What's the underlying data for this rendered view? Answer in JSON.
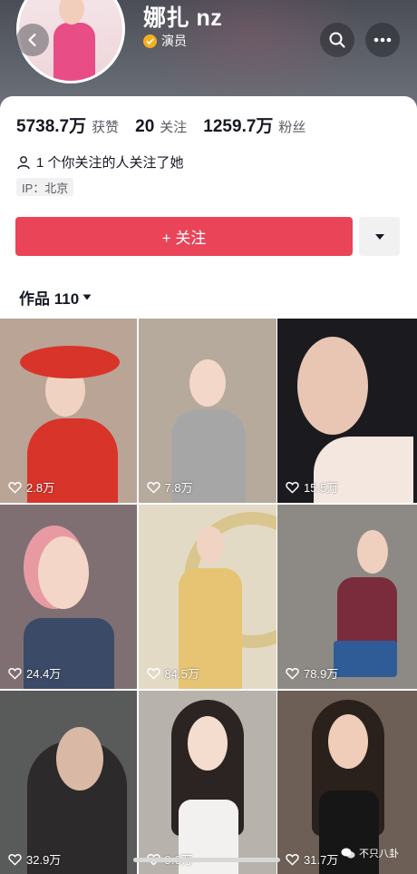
{
  "profile": {
    "name": "娜扎 nz",
    "verify_label": "演员",
    "stats": [
      {
        "value": "5738.7万",
        "label": "获赞"
      },
      {
        "value": "20",
        "label": "关注"
      },
      {
        "value": "1259.7万",
        "label": "粉丝"
      }
    ],
    "mutual_text": "1 个你关注的人关注了她",
    "ip_text": "IP：北京"
  },
  "actions": {
    "follow_label": "+ 关注"
  },
  "tabs": {
    "works_label": "作品 110"
  },
  "videos": [
    {
      "likes": "2.8万",
      "bg": "#b9a496",
      "accent": "#d8342a"
    },
    {
      "likes": "7.8万",
      "bg": "#b5aa9c",
      "accent": "#a7a6a6"
    },
    {
      "likes": "15.5万",
      "bg": "#1b1b1f",
      "accent": "#f4e7e0"
    },
    {
      "likes": "24.4万",
      "bg": "#7f6f72",
      "accent": "#3b4a66"
    },
    {
      "likes": "84.5万",
      "bg": "#e3dac6",
      "accent": "#e6c473"
    },
    {
      "likes": "78.9万",
      "bg": "#8d8a86",
      "accent": "#7a2c3d"
    },
    {
      "likes": "32.9万",
      "bg": "#595a5a",
      "accent": "#2c2a2a"
    },
    {
      "likes": "9.6万",
      "bg": "#b7b2ac",
      "accent": "#f3f1ef"
    },
    {
      "likes": "31.7万",
      "bg": "#6d5f55",
      "accent": "#161616"
    }
  ],
  "watermark": "不只八卦",
  "colors": {
    "follow_button": "#ea4459",
    "verify_badge": "#f2b020"
  }
}
